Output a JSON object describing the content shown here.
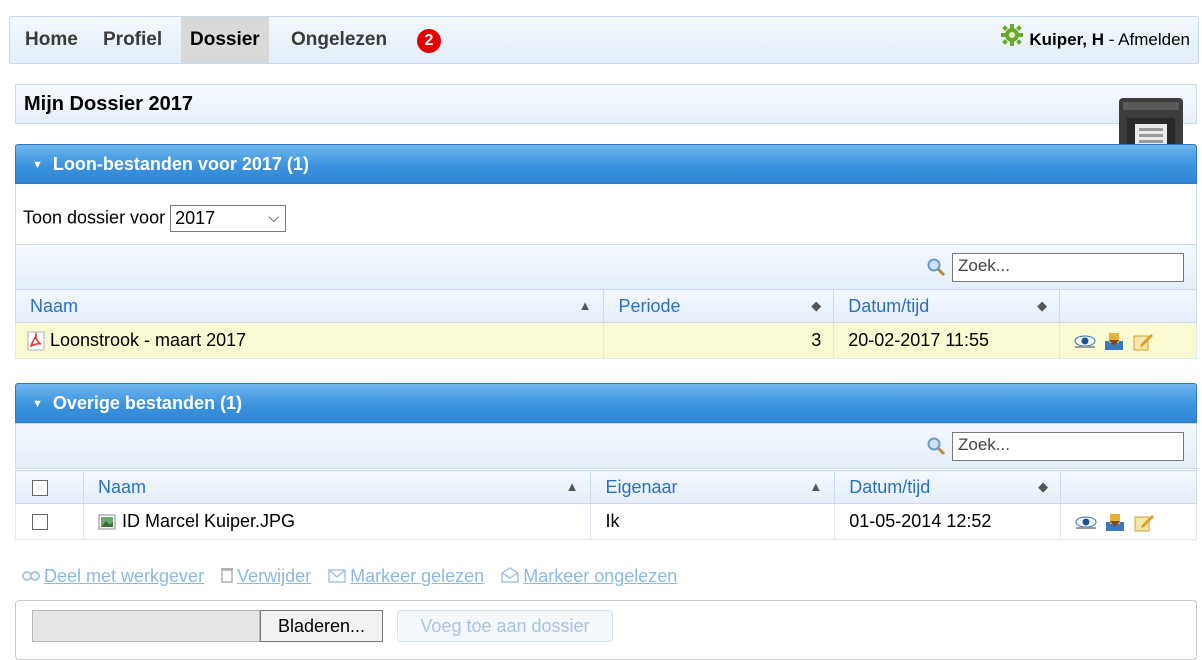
{
  "nav": {
    "items": [
      {
        "label": "Home",
        "active": false
      },
      {
        "label": "Profiel",
        "active": false
      },
      {
        "label": "Dossier",
        "active": true
      },
      {
        "label": "Ongelezen",
        "active": false
      }
    ],
    "unread_count": "2",
    "user_name": "Kuiper, H",
    "separator": " - ",
    "logout_label": "Afmelden"
  },
  "page_title": "Mijn Dossier 2017",
  "loon": {
    "header": "Loon-bestanden voor 2017 (1)",
    "select_label": "Toon dossier voor",
    "selected_year": "2017",
    "search_placeholder": "Zoek...",
    "columns": [
      "Naam",
      "Periode",
      "Datum/tijd"
    ],
    "rows": [
      {
        "name": "Loonstrook - maart 2017",
        "periode": "3",
        "datum": "20-02-2017 11:55"
      }
    ]
  },
  "overige": {
    "header": "Overige bestanden (1)",
    "search_placeholder": "Zoek...",
    "columns": [
      "Naam",
      "Eigenaar",
      "Datum/tijd"
    ],
    "rows": [
      {
        "name": "ID Marcel Kuiper.JPG",
        "eigenaar": "Ik",
        "datum": "01-05-2014 12:52"
      }
    ]
  },
  "actions": {
    "share": "Deel met werkgever",
    "delete": "Verwijder",
    "mark_read": "Markeer gelezen",
    "mark_unread": "Markeer ongelezen"
  },
  "upload": {
    "browse_label": "Bladeren...",
    "add_label": "Voeg toe aan dossier"
  },
  "colors": {
    "header_blue": "#3b93de",
    "link_blue": "#2a6fc0",
    "highlight_row": "#fafad2",
    "badge_red": "#e40000"
  }
}
